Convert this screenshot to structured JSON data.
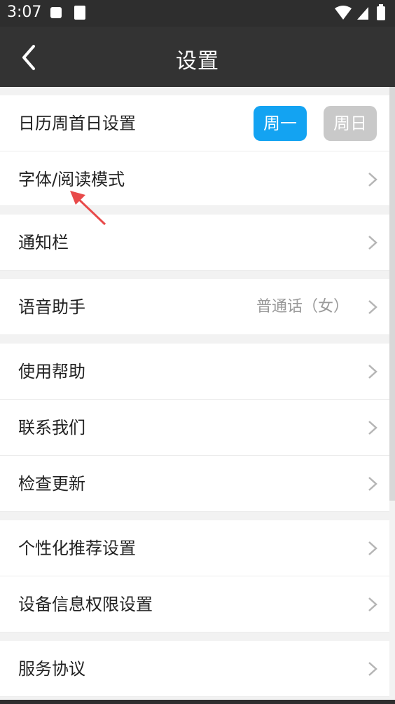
{
  "status": {
    "time": "3:07"
  },
  "header": {
    "title": "设置"
  },
  "rows": {
    "calendar": {
      "label": "日历周首日设置",
      "mon": "周一",
      "sun": "周日"
    },
    "font": {
      "label": "字体/阅读模式"
    },
    "notify": {
      "label": "通知栏"
    },
    "voice": {
      "label": "语音助手",
      "value": "普通话（女）"
    },
    "help": {
      "label": "使用帮助"
    },
    "contact": {
      "label": "联系我们"
    },
    "update": {
      "label": "检查更新"
    },
    "personal": {
      "label": "个性化推荐设置"
    },
    "device": {
      "label": "设备信息权限设置"
    },
    "service": {
      "label": "服务协议"
    }
  },
  "colors": {
    "accent": "#13a3f2",
    "disabled": "#c9c9c9",
    "appbar": "#333333",
    "annotation_arrow": "#e84a4a"
  }
}
